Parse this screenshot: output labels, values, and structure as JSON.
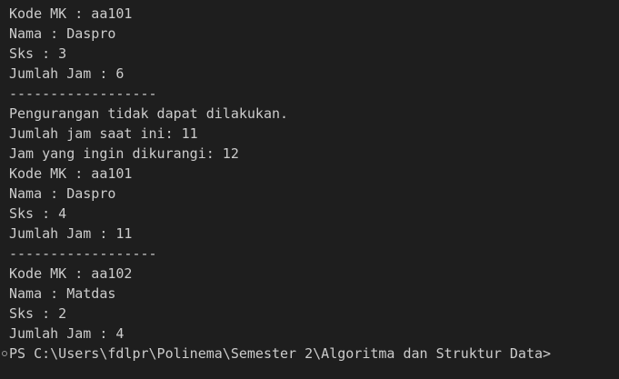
{
  "terminal": {
    "lines": [
      "Kode MK : aa101",
      "Nama : Daspro",
      "Sks : 3",
      "Jumlah Jam : 6",
      "------------------",
      "Pengurangan tidak dapat dilakukan.",
      "Jumlah jam saat ini: 11",
      "Jam yang ingin dikurangi: 12",
      "Kode MK : aa101",
      "Nama : Daspro",
      "Sks : 4",
      "Jumlah Jam : 11",
      "------------------",
      "Kode MK : aa102",
      "Nama : Matdas",
      "Sks : 2",
      "Jumlah Jam : 4"
    ],
    "prompt": "PS C:\\Users\\fdlpr\\Polinema\\Semester 2\\Algoritma dan Struktur Data>"
  },
  "colors": {
    "background": "#1e1e1e",
    "text": "#cccccc"
  }
}
